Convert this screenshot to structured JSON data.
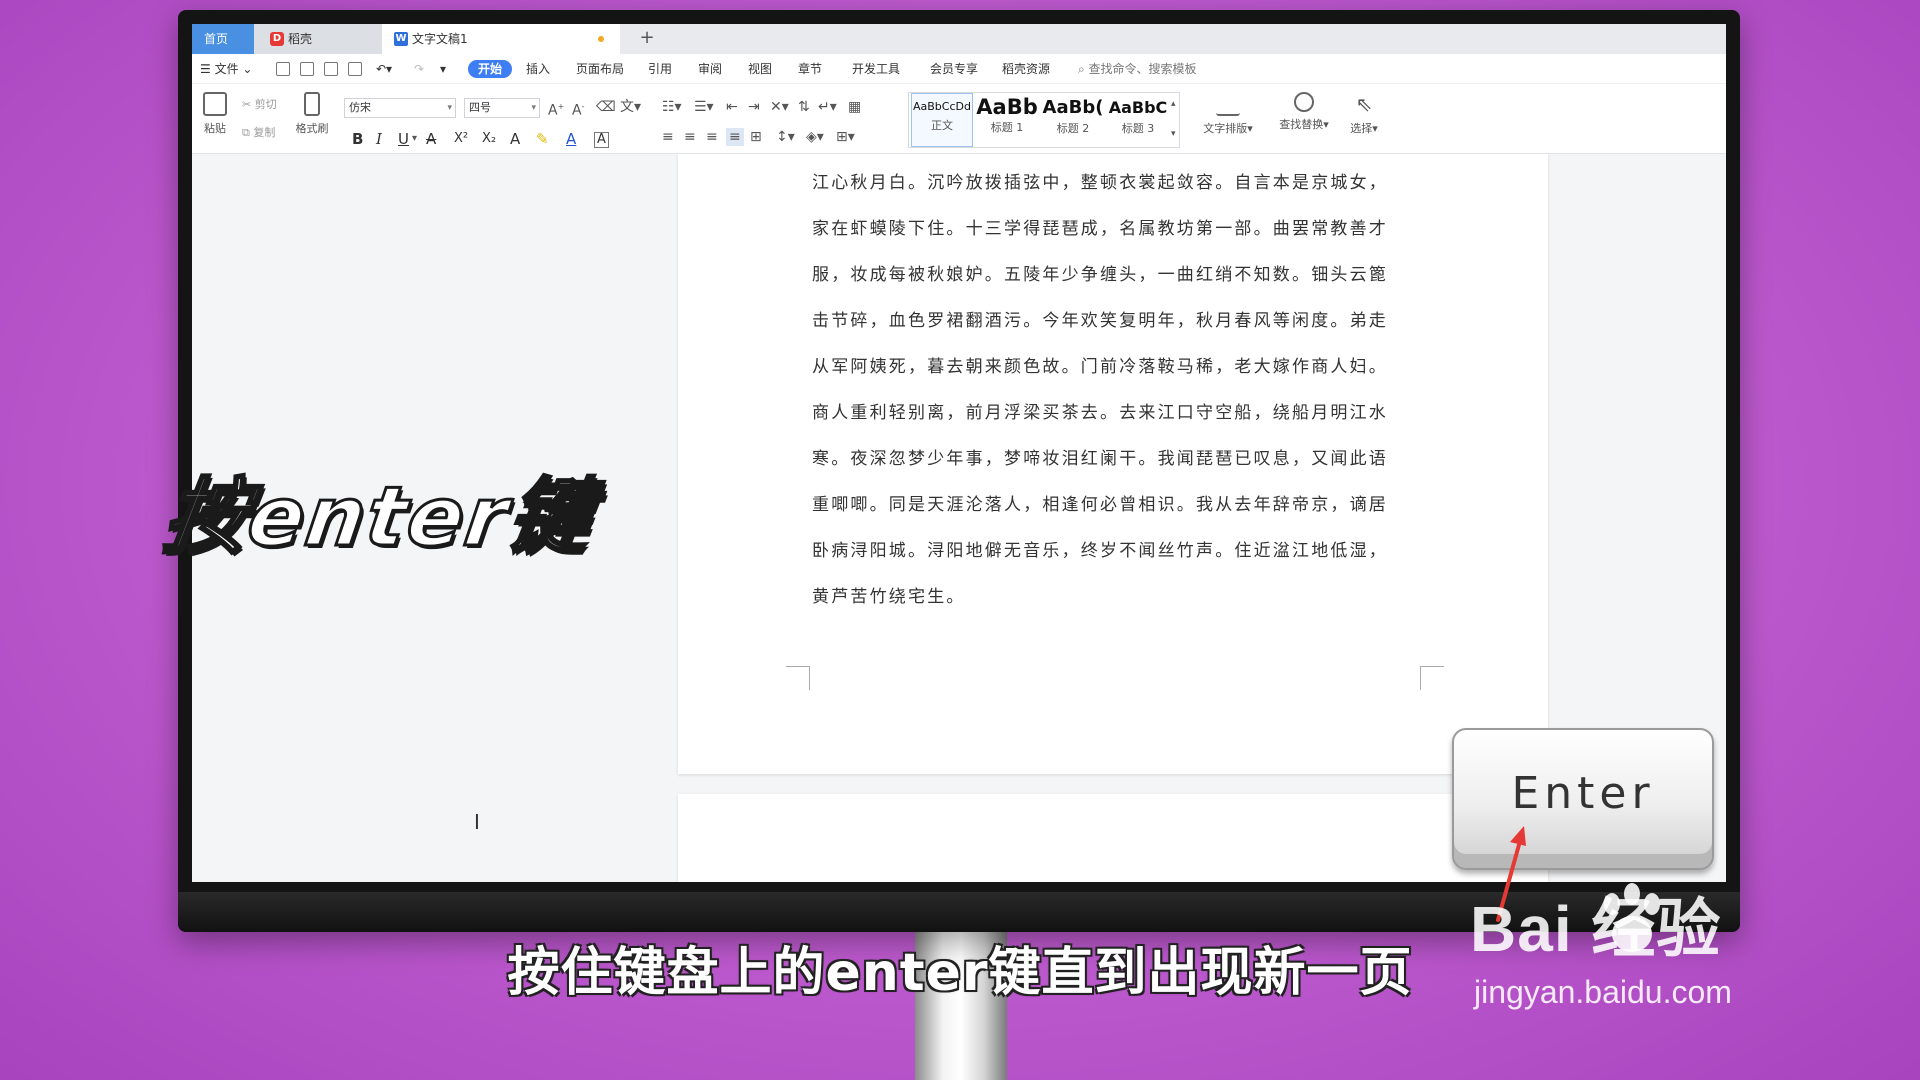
{
  "tabs": {
    "home": "首页",
    "straw": "稻壳",
    "doc": "文字文稿1",
    "add": "+"
  },
  "menu": {
    "file": "文件",
    "items": [
      "开始",
      "插入",
      "页面布局",
      "引用",
      "审阅",
      "视图",
      "章节",
      "开发工具",
      "会员专享",
      "稻壳资源"
    ],
    "search": "查找命令、搜索模板"
  },
  "ribbon": {
    "paste": "粘贴",
    "cut": "剪切",
    "copy": "复制",
    "format_painter": "格式刷",
    "font": "仿宋",
    "font_size": "四号",
    "bold": "B",
    "italic": "I",
    "underline": "U",
    "superscript": "X²",
    "subscript": "X₂",
    "styles": [
      {
        "preview": "AaBbCcDd",
        "name": "正文"
      },
      {
        "preview": "AaBb",
        "name": "标题 1"
      },
      {
        "preview": "AaBb(",
        "name": "标题 2"
      },
      {
        "preview": "AaBbC",
        "name": "标题 3"
      }
    ],
    "text_layout": "文字排版",
    "find_replace": "查找替换",
    "select": "选择"
  },
  "document": {
    "lines": [
      "江心秋月白。沉吟放拨插弦中，整顿衣裳起敛容。自言本是京城女，",
      "家在虾蟆陵下住。十三学得琵琶成，名属教坊第一部。曲罢常教善才",
      "服，妆成每被秋娘妒。五陵年少争缠头，一曲红绡不知数。钿头云篦",
      "击节碎，血色罗裙翻酒污。今年欢笑复明年，秋月春风等闲度。弟走",
      "从军阿姨死，暮去朝来颜色故。门前冷落鞍马稀，老大嫁作商人妇。",
      "商人重利轻别离，前月浮梁买茶去。去来江口守空船，绕船月明江水",
      "寒。夜深忽梦少年事，梦啼妆泪红阑干。我闻琵琶已叹息，又闻此语",
      "重唧唧。同是天涯沦落人，相逢何必曾相识。我从去年辞帝京，谪居",
      "卧病浔阳城。浔阳地僻无音乐，终岁不闻丝竹声。住近湓江地低湿，",
      "黄芦苦竹绕宅生。"
    ]
  },
  "overlay": {
    "left_caption": "按enter键",
    "enter_key": "Enter",
    "subtitle": "按住键盘上的enter键直到出现新一页"
  },
  "watermark": {
    "main": "Bai  经验",
    "url": "jingyan.baidu.com"
  },
  "colors": {
    "accent": "#3d7ef5",
    "background": "#c35fd2",
    "arrow": "#e53935"
  }
}
